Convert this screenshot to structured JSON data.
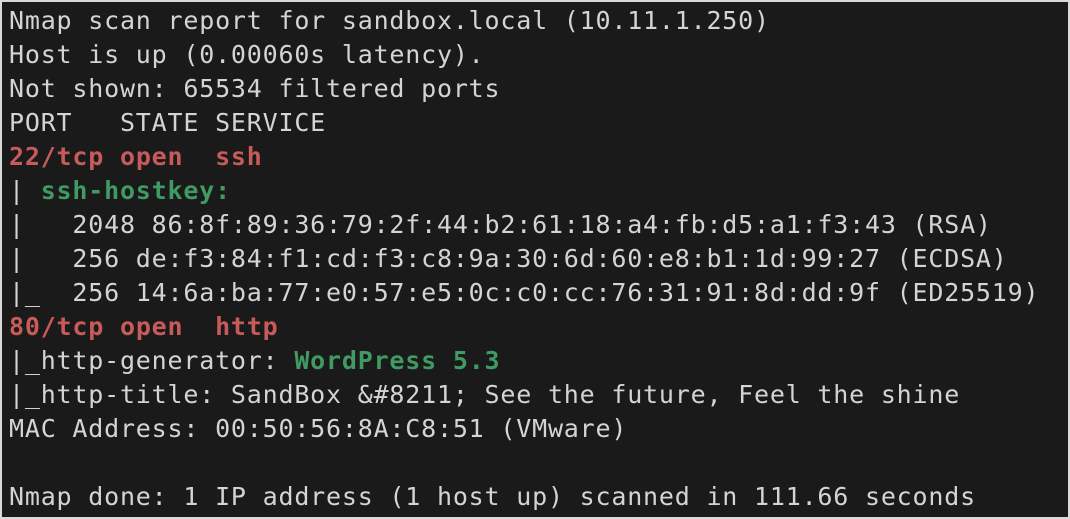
{
  "terminal": {
    "lines": [
      "Nmap scan report for sandbox.local (10.11.1.250)",
      "Host is up (0.00060s latency).",
      "Not shown: 65534 filtered ports",
      "PORT   STATE SERVICE",
      {
        "port": "22/tcp",
        "state": "open",
        "service": "ssh"
      },
      {
        "prefix": "| ",
        "script": "ssh-hostkey:"
      },
      "|   2048 86:8f:89:36:79:2f:44:b2:61:18:a4:fb:d5:a1:f3:43 (RSA)",
      "|   256 de:f3:84:f1:cd:f3:c8:9a:30:6d:60:e8:b1:1d:99:27 (ECDSA)",
      "|_  256 14:6a:ba:77:e0:57:e5:0c:c0:cc:76:31:91:8d:dd:9f (ED25519)",
      {
        "port": "80/tcp",
        "state": "open",
        "service": "http"
      },
      {
        "prefix": "|_http-generator: ",
        "value": "WordPress 5.3"
      },
      "|_http-title: SandBox &#8211; See the future, Feel the shine",
      "MAC Address: 00:50:56:8A:C8:51 (VMware)",
      "",
      "Nmap done: 1 IP address (1 host up) scanned in 111.66 seconds"
    ]
  },
  "colors": {
    "background": "#1a1a1a",
    "text": "#d4d4d4",
    "port_highlight": "#c75a5a",
    "script_highlight": "#3f9a63"
  }
}
